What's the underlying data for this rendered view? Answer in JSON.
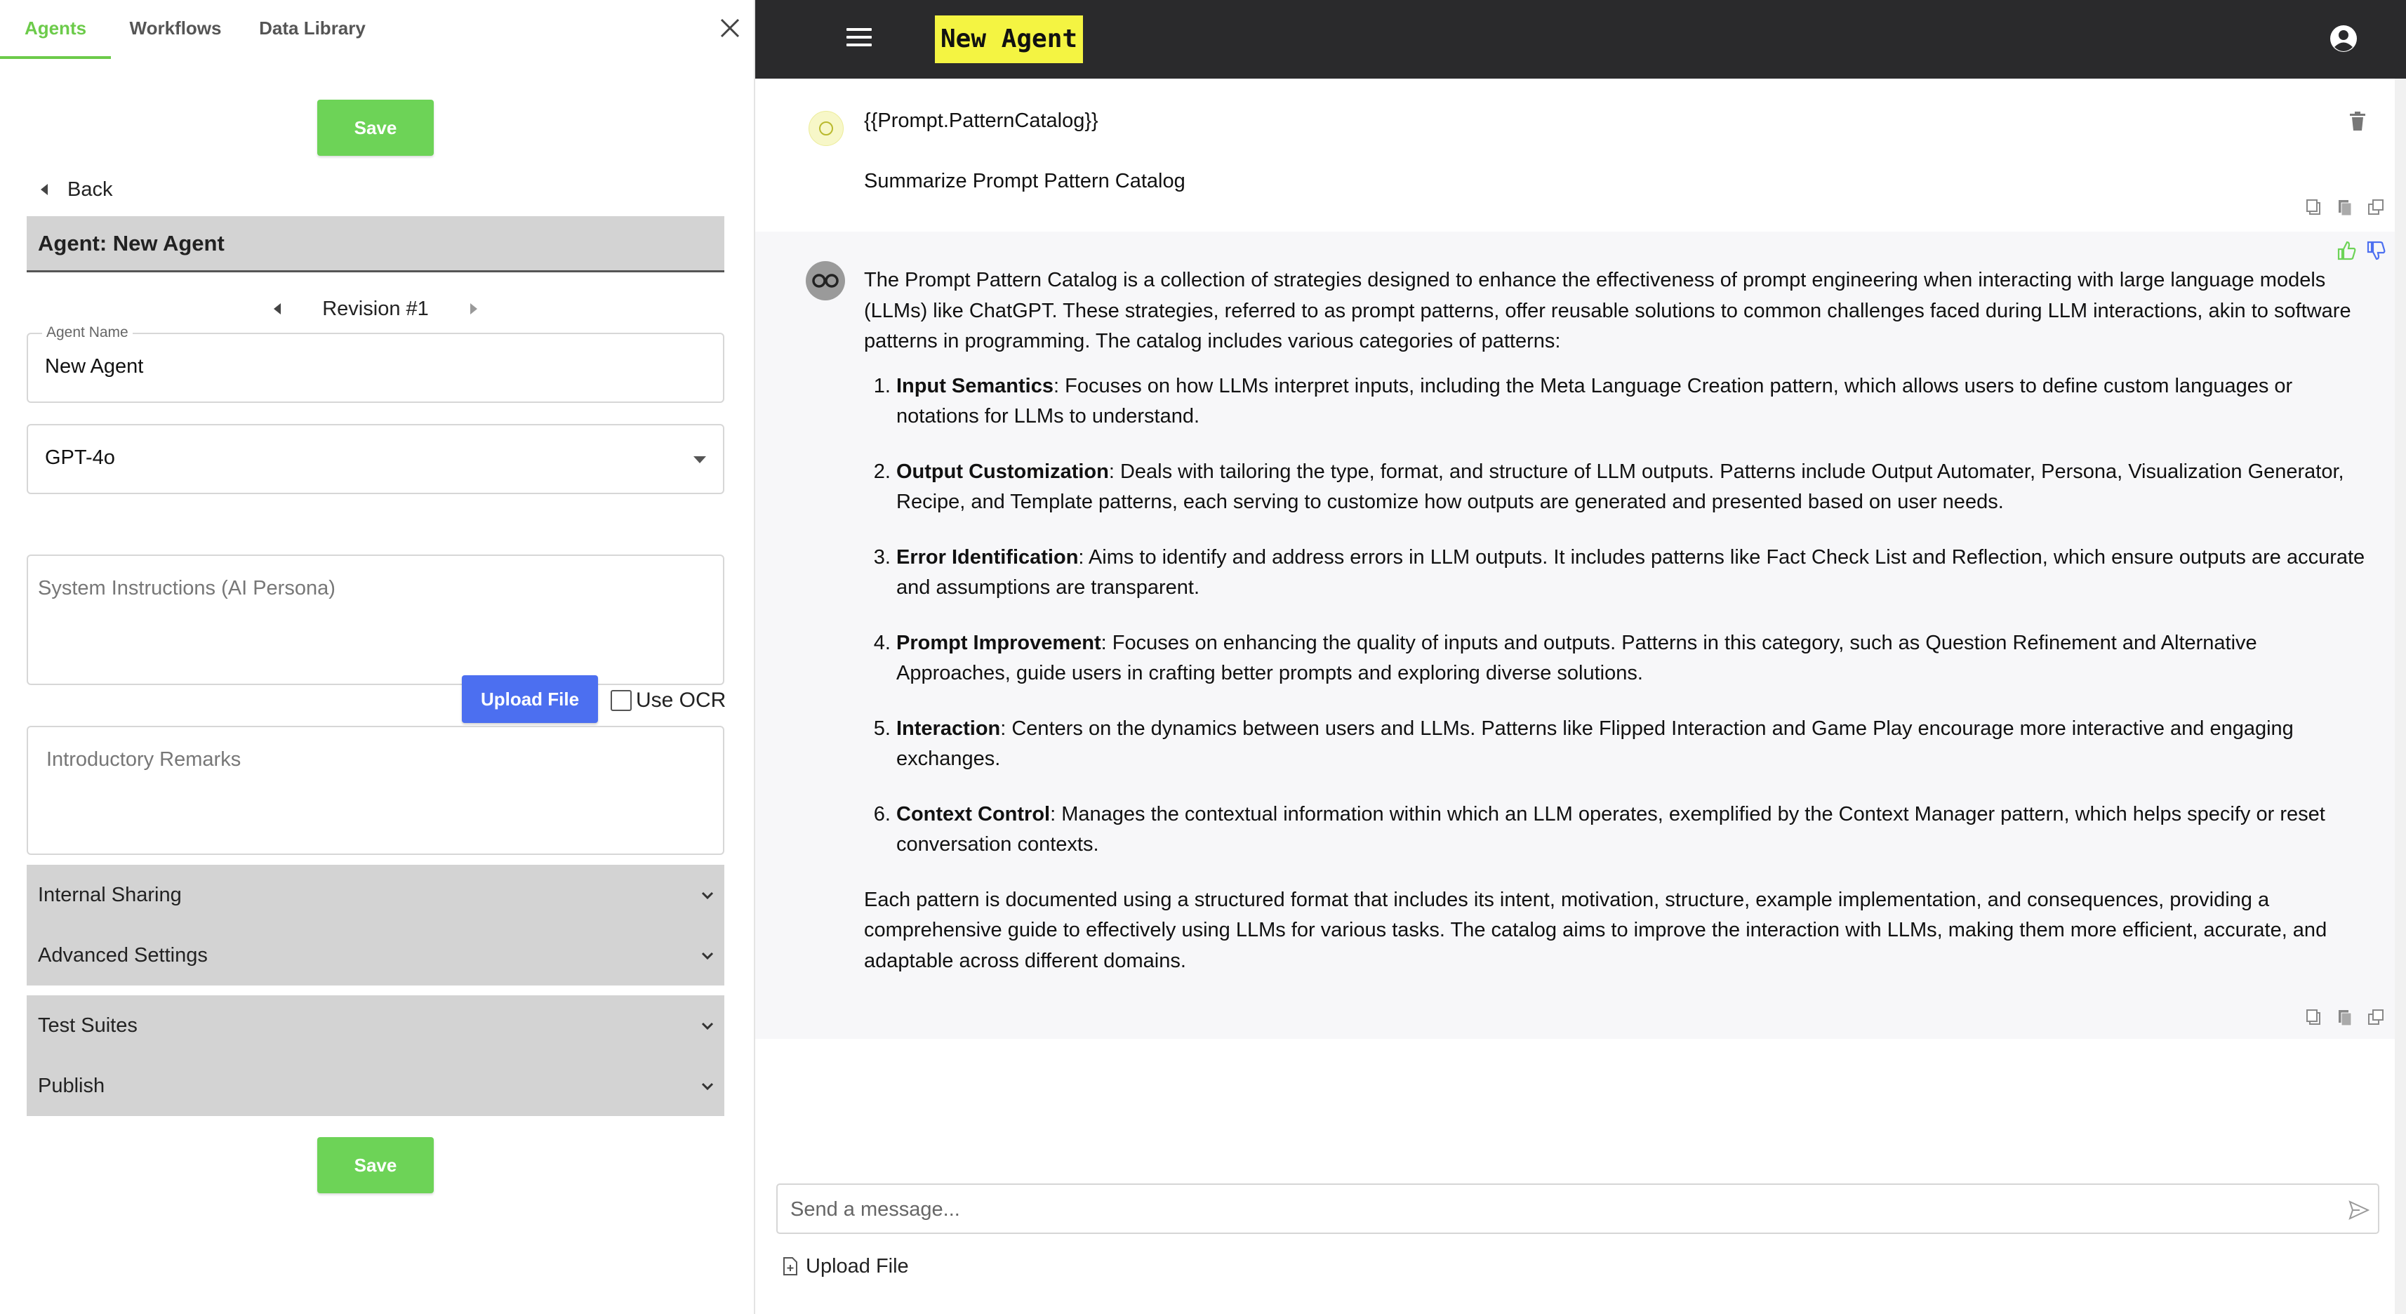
{
  "left_panel": {
    "tabs": [
      {
        "label": "Agents",
        "active": true
      },
      {
        "label": "Workflows",
        "active": false
      },
      {
        "label": "Data Library",
        "active": false
      }
    ],
    "save_label": "Save",
    "back_label": "Back",
    "agent_header": "Agent: New Agent",
    "revision_label": "Revision #1",
    "agent_name": {
      "label": "Agent Name",
      "value": "New Agent"
    },
    "model": {
      "selected": "GPT-4o"
    },
    "system_instructions": {
      "placeholder": "System Instructions (AI Persona)"
    },
    "upload_label": "Upload File",
    "ocr_label": "Use OCR",
    "intro_remarks": {
      "placeholder": "Introductory Remarks"
    },
    "accordions_group1": [
      "Internal Sharing",
      "Advanced Settings"
    ],
    "accordions_group2": [
      "Test Suites",
      "Publish"
    ]
  },
  "chat": {
    "title": "New Agent",
    "user_message": {
      "line1": "{{Prompt.PatternCatalog}}",
      "line2": "Summarize Prompt Pattern Catalog"
    },
    "bot_message": {
      "intro": "The Prompt Pattern Catalog is a collection of strategies designed to enhance the effectiveness of prompt engineering when interacting with large language models (LLMs) like ChatGPT. These strategies, referred to as prompt patterns, offer reusable solutions to common challenges faced during LLM interactions, akin to software patterns in programming. The catalog includes various categories of patterns:",
      "items": [
        {
          "title": "Input Semantics",
          "text": ": Focuses on how LLMs interpret inputs, including the Meta Language Creation pattern, which allows users to define custom languages or notations for LLMs to understand."
        },
        {
          "title": "Output Customization",
          "text": ": Deals with tailoring the type, format, and structure of LLM outputs. Patterns include Output Automater, Persona, Visualization Generator, Recipe, and Template patterns, each serving to customize how outputs are generated and presented based on user needs."
        },
        {
          "title": "Error Identification",
          "text": ": Aims to identify and address errors in LLM outputs. It includes patterns like Fact Check List and Reflection, which ensure outputs are accurate and assumptions are transparent."
        },
        {
          "title": "Prompt Improvement",
          "text": ": Focuses on enhancing the quality of inputs and outputs. Patterns in this category, such as Question Refinement and Alternative Approaches, guide users in crafting better prompts and exploring diverse solutions."
        },
        {
          "title": "Interaction",
          "text": ": Centers on the dynamics between users and LLMs. Patterns like Flipped Interaction and Game Play encourage more interactive and engaging exchanges."
        },
        {
          "title": "Context Control",
          "text": ": Manages the contextual information within which an LLM operates, exemplified by the Context Manager pattern, which helps specify or reset conversation contexts."
        }
      ],
      "outro": "Each pattern is documented using a structured format that includes its intent, motivation, structure, example implementation, and consequences, providing a comprehensive guide to effectively using LLMs for various tasks. The catalog aims to improve the interaction with LLMs, making them more efficient, accurate, and adaptable across different domains."
    },
    "composer": {
      "placeholder": "Send a message..."
    },
    "upload_label": "Upload File"
  },
  "colors": {
    "accent_green": "#6dd357",
    "upload_blue": "#4c6ff0",
    "topbar": "#2a2a2c",
    "title_badge": "#f4f442"
  }
}
